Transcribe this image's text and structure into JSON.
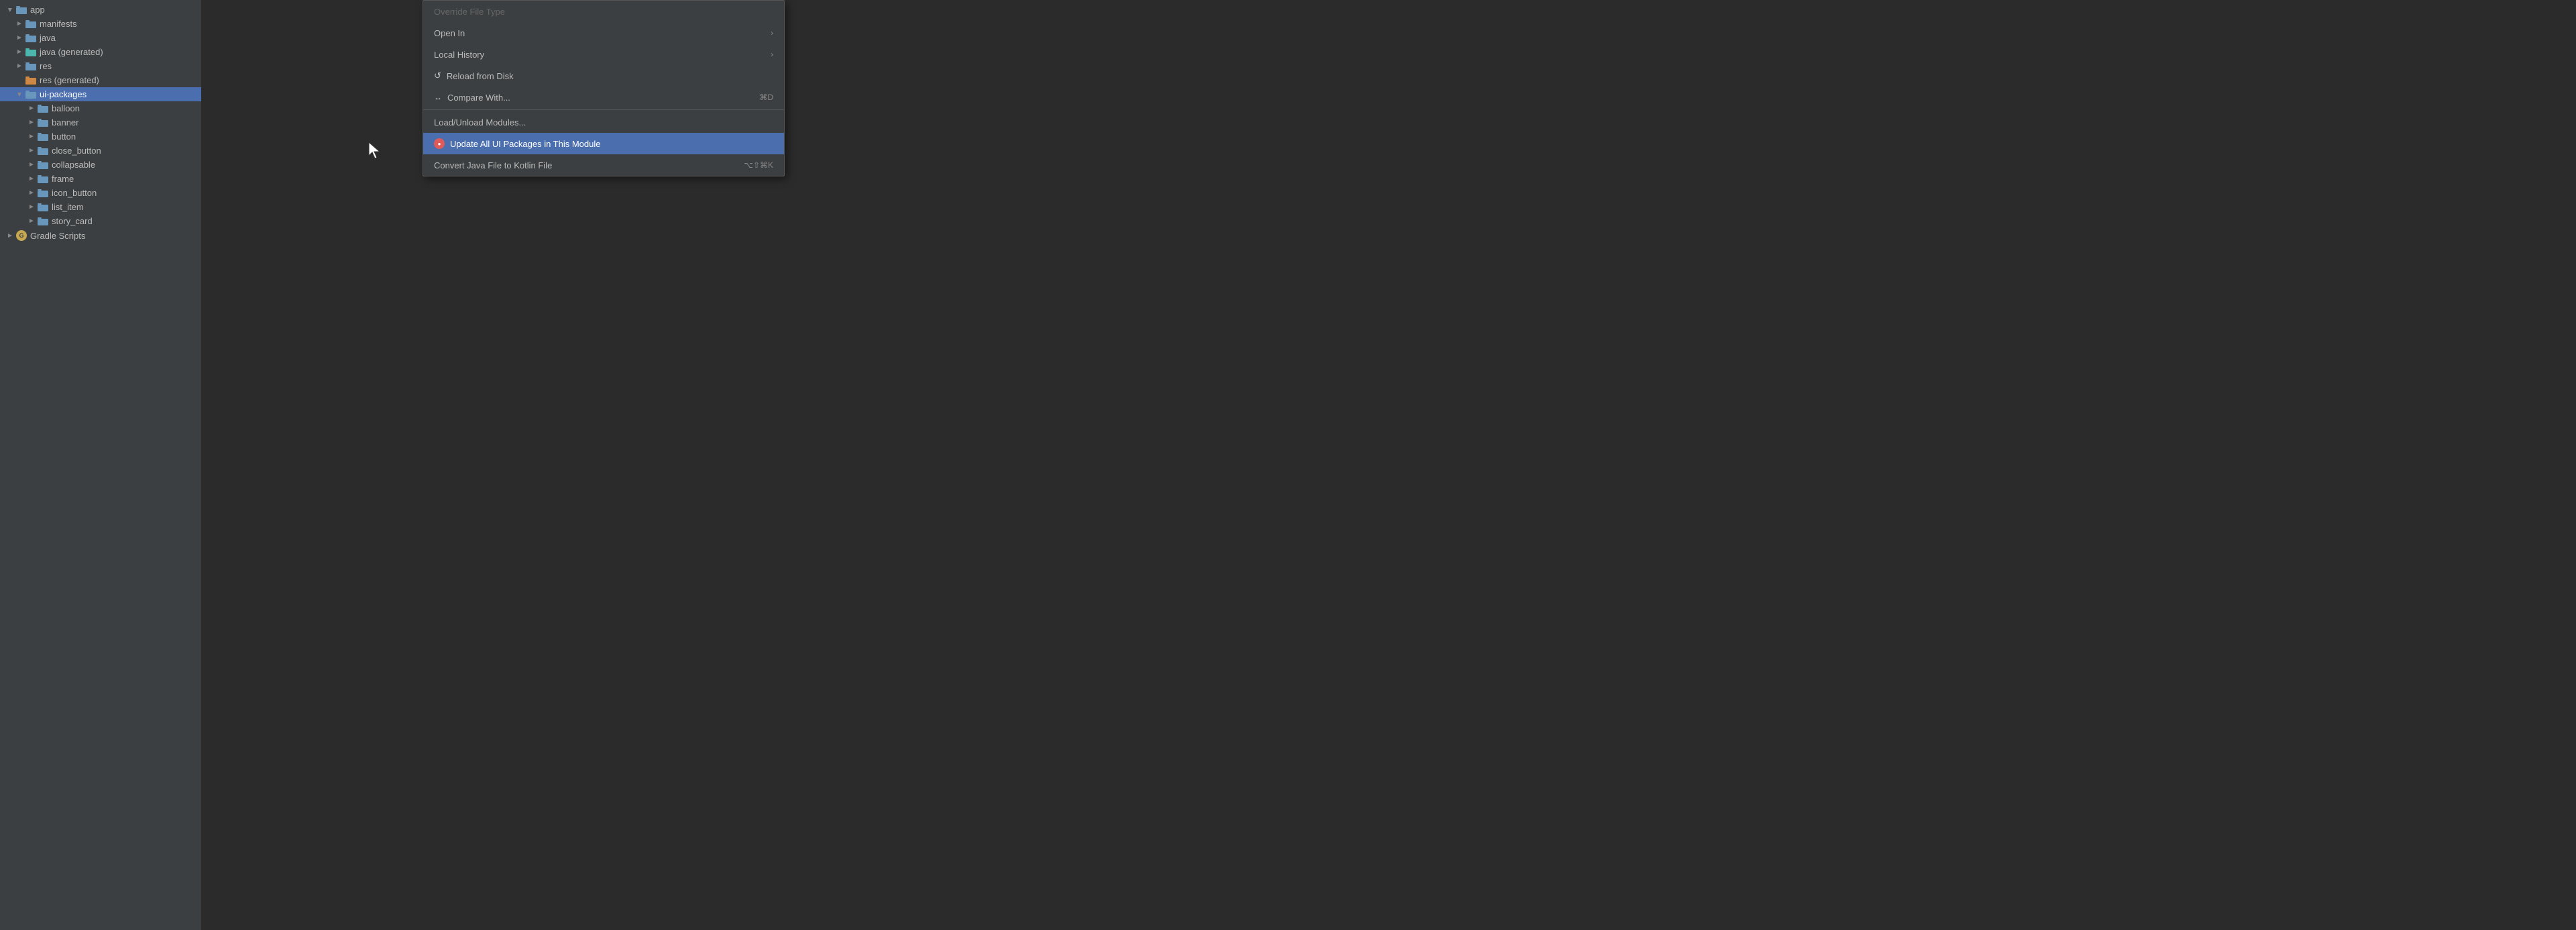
{
  "sidebar": {
    "items": [
      {
        "id": "app",
        "label": "app",
        "indent": 0,
        "type": "folder-blue",
        "arrow": "expanded",
        "selected": false
      },
      {
        "id": "manifests",
        "label": "manifests",
        "indent": 1,
        "type": "folder-blue",
        "arrow": "collapsed",
        "selected": false
      },
      {
        "id": "java",
        "label": "java",
        "indent": 1,
        "type": "folder-blue",
        "arrow": "collapsed",
        "selected": false
      },
      {
        "id": "java-generated",
        "label": "java (generated)",
        "indent": 1,
        "type": "folder-teal",
        "arrow": "collapsed",
        "selected": false
      },
      {
        "id": "res",
        "label": "res",
        "indent": 1,
        "type": "folder-blue",
        "arrow": "collapsed",
        "selected": false
      },
      {
        "id": "res-generated",
        "label": "res (generated)",
        "indent": 1,
        "type": "folder-orange",
        "arrow": "none",
        "selected": false
      },
      {
        "id": "ui-packages",
        "label": "ui-packages",
        "indent": 1,
        "type": "folder-blue",
        "arrow": "expanded",
        "selected": true
      },
      {
        "id": "balloon",
        "label": "balloon",
        "indent": 2,
        "type": "folder-blue",
        "arrow": "collapsed",
        "selected": false
      },
      {
        "id": "banner",
        "label": "banner",
        "indent": 2,
        "type": "folder-blue",
        "arrow": "collapsed",
        "selected": false
      },
      {
        "id": "button",
        "label": "button",
        "indent": 2,
        "type": "folder-blue",
        "arrow": "collapsed",
        "selected": false
      },
      {
        "id": "close_button",
        "label": "close_button",
        "indent": 2,
        "type": "folder-blue",
        "arrow": "collapsed",
        "selected": false
      },
      {
        "id": "collapsable",
        "label": "collapsable",
        "indent": 2,
        "type": "folder-blue",
        "arrow": "collapsed",
        "selected": false
      },
      {
        "id": "frame",
        "label": "frame",
        "indent": 2,
        "type": "folder-blue",
        "arrow": "collapsed",
        "selected": false
      },
      {
        "id": "icon_button",
        "label": "icon_button",
        "indent": 2,
        "type": "folder-blue",
        "arrow": "collapsed",
        "selected": false
      },
      {
        "id": "list_item",
        "label": "list_item",
        "indent": 2,
        "type": "folder-blue",
        "arrow": "collapsed",
        "selected": false
      },
      {
        "id": "story_card",
        "label": "story_card",
        "indent": 2,
        "type": "folder-blue",
        "arrow": "collapsed",
        "selected": false
      },
      {
        "id": "gradle-scripts",
        "label": "Gradle Scripts",
        "indent": 0,
        "type": "gradle",
        "arrow": "collapsed",
        "selected": false
      }
    ]
  },
  "context_menu": {
    "items": [
      {
        "id": "override-file-type",
        "label": "Override File Type",
        "shortcut": "",
        "arrow": false,
        "disabled": true,
        "icon": null,
        "separator_before": false,
        "highlighted": false
      },
      {
        "id": "open-in",
        "label": "Open In",
        "shortcut": "",
        "arrow": true,
        "disabled": false,
        "icon": null,
        "separator_before": false,
        "highlighted": false
      },
      {
        "id": "local-history",
        "label": "Local History",
        "shortcut": "",
        "arrow": true,
        "disabled": false,
        "icon": null,
        "separator_before": false,
        "highlighted": false
      },
      {
        "id": "reload-from-disk",
        "label": "Reload from Disk",
        "shortcut": "",
        "arrow": false,
        "disabled": false,
        "icon": "reload",
        "separator_before": false,
        "highlighted": false
      },
      {
        "id": "compare-with",
        "label": "Compare With...",
        "shortcut": "⌘D",
        "arrow": false,
        "disabled": false,
        "icon": "compare",
        "separator_before": false,
        "highlighted": false
      },
      {
        "id": "separator-1",
        "type": "separator"
      },
      {
        "id": "load-unload-modules",
        "label": "Load/Unload Modules...",
        "shortcut": "",
        "arrow": false,
        "disabled": false,
        "icon": null,
        "separator_before": false,
        "highlighted": false
      },
      {
        "id": "update-all-ui-packages",
        "label": "Update All UI Packages in This Module",
        "shortcut": "",
        "arrow": false,
        "disabled": false,
        "icon": "update",
        "separator_before": false,
        "highlighted": true
      },
      {
        "id": "convert-java-kotlin",
        "label": "Convert Java File to Kotlin File",
        "shortcut": "⌥⇧⌘K",
        "arrow": false,
        "disabled": false,
        "icon": null,
        "separator_before": false,
        "highlighted": false
      }
    ]
  }
}
